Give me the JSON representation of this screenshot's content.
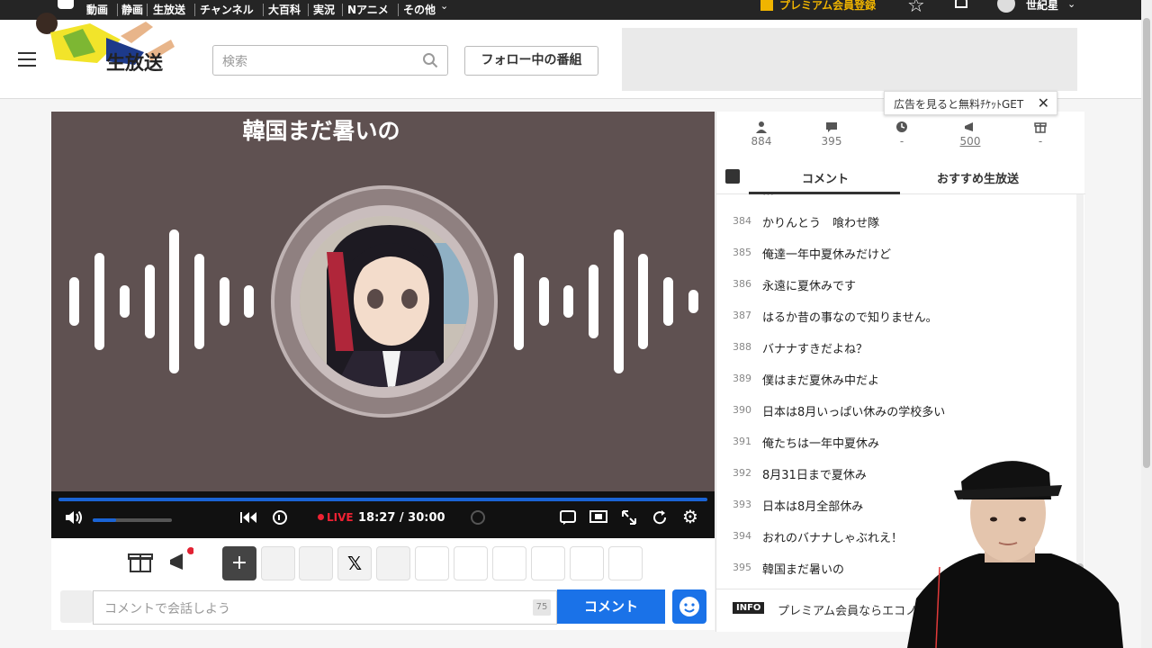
{
  "topnav": {
    "items": [
      "動画",
      "静画",
      "生放送",
      "チャンネル",
      "大百科",
      "実況",
      "Nアニメ",
      "その他"
    ],
    "premium_label": "プレミアム会員登録",
    "user_name": "世紀星"
  },
  "header": {
    "logo_text": "生放送",
    "search_placeholder": "検索",
    "follow_button": "フォロー中の番組"
  },
  "player": {
    "title": "韓国まだ暑いの",
    "live_label": "LIVE",
    "time": "18:27 / 30:00",
    "progress_fraction": 1.0,
    "volume_fraction": 0.3
  },
  "comment_input": {
    "placeholder": "コメントで会話しよう",
    "char_count": "75",
    "submit_label": "コメント"
  },
  "stats": {
    "viewers": "884",
    "comments": "395",
    "time": "-",
    "ads": "500",
    "gifts": "-"
  },
  "tabs": {
    "comment": "コメント",
    "recommended": "おすすめ生放送"
  },
  "comments": [
    {
      "num": "384",
      "text": "かりんとう　喰わせ隊"
    },
    {
      "num": "385",
      "text": "俺達一年中夏休みだけど"
    },
    {
      "num": "386",
      "text": "永遠に夏休みです"
    },
    {
      "num": "387",
      "text": "はるか昔の事なので知りません。"
    },
    {
      "num": "388",
      "text": "バナナすきだよね？"
    },
    {
      "num": "389",
      "text": "僕はまだ夏休み中だよ"
    },
    {
      "num": "390",
      "text": "日本は8月いっぱい休みの学校多い"
    },
    {
      "num": "391",
      "text": "俺たちは一年中夏休み"
    },
    {
      "num": "392",
      "text": "8月31日まで夏休み"
    },
    {
      "num": "393",
      "text": "日本は8月全部休み"
    },
    {
      "num": "394",
      "text": "おれのバナナしゃぶれえ！"
    },
    {
      "num": "395",
      "text": "韓国まだ暑いの"
    }
  ],
  "info": {
    "badge": "INFO",
    "text": "プレミアム会員ならエコノ"
  },
  "tooltip": {
    "text": "広告を見ると無料ﾁｹｯﾄGET"
  },
  "colors": {
    "accent": "#1a72e8",
    "live": "#e22233",
    "premium": "#f0b400",
    "player_bg": "#5f5151"
  }
}
